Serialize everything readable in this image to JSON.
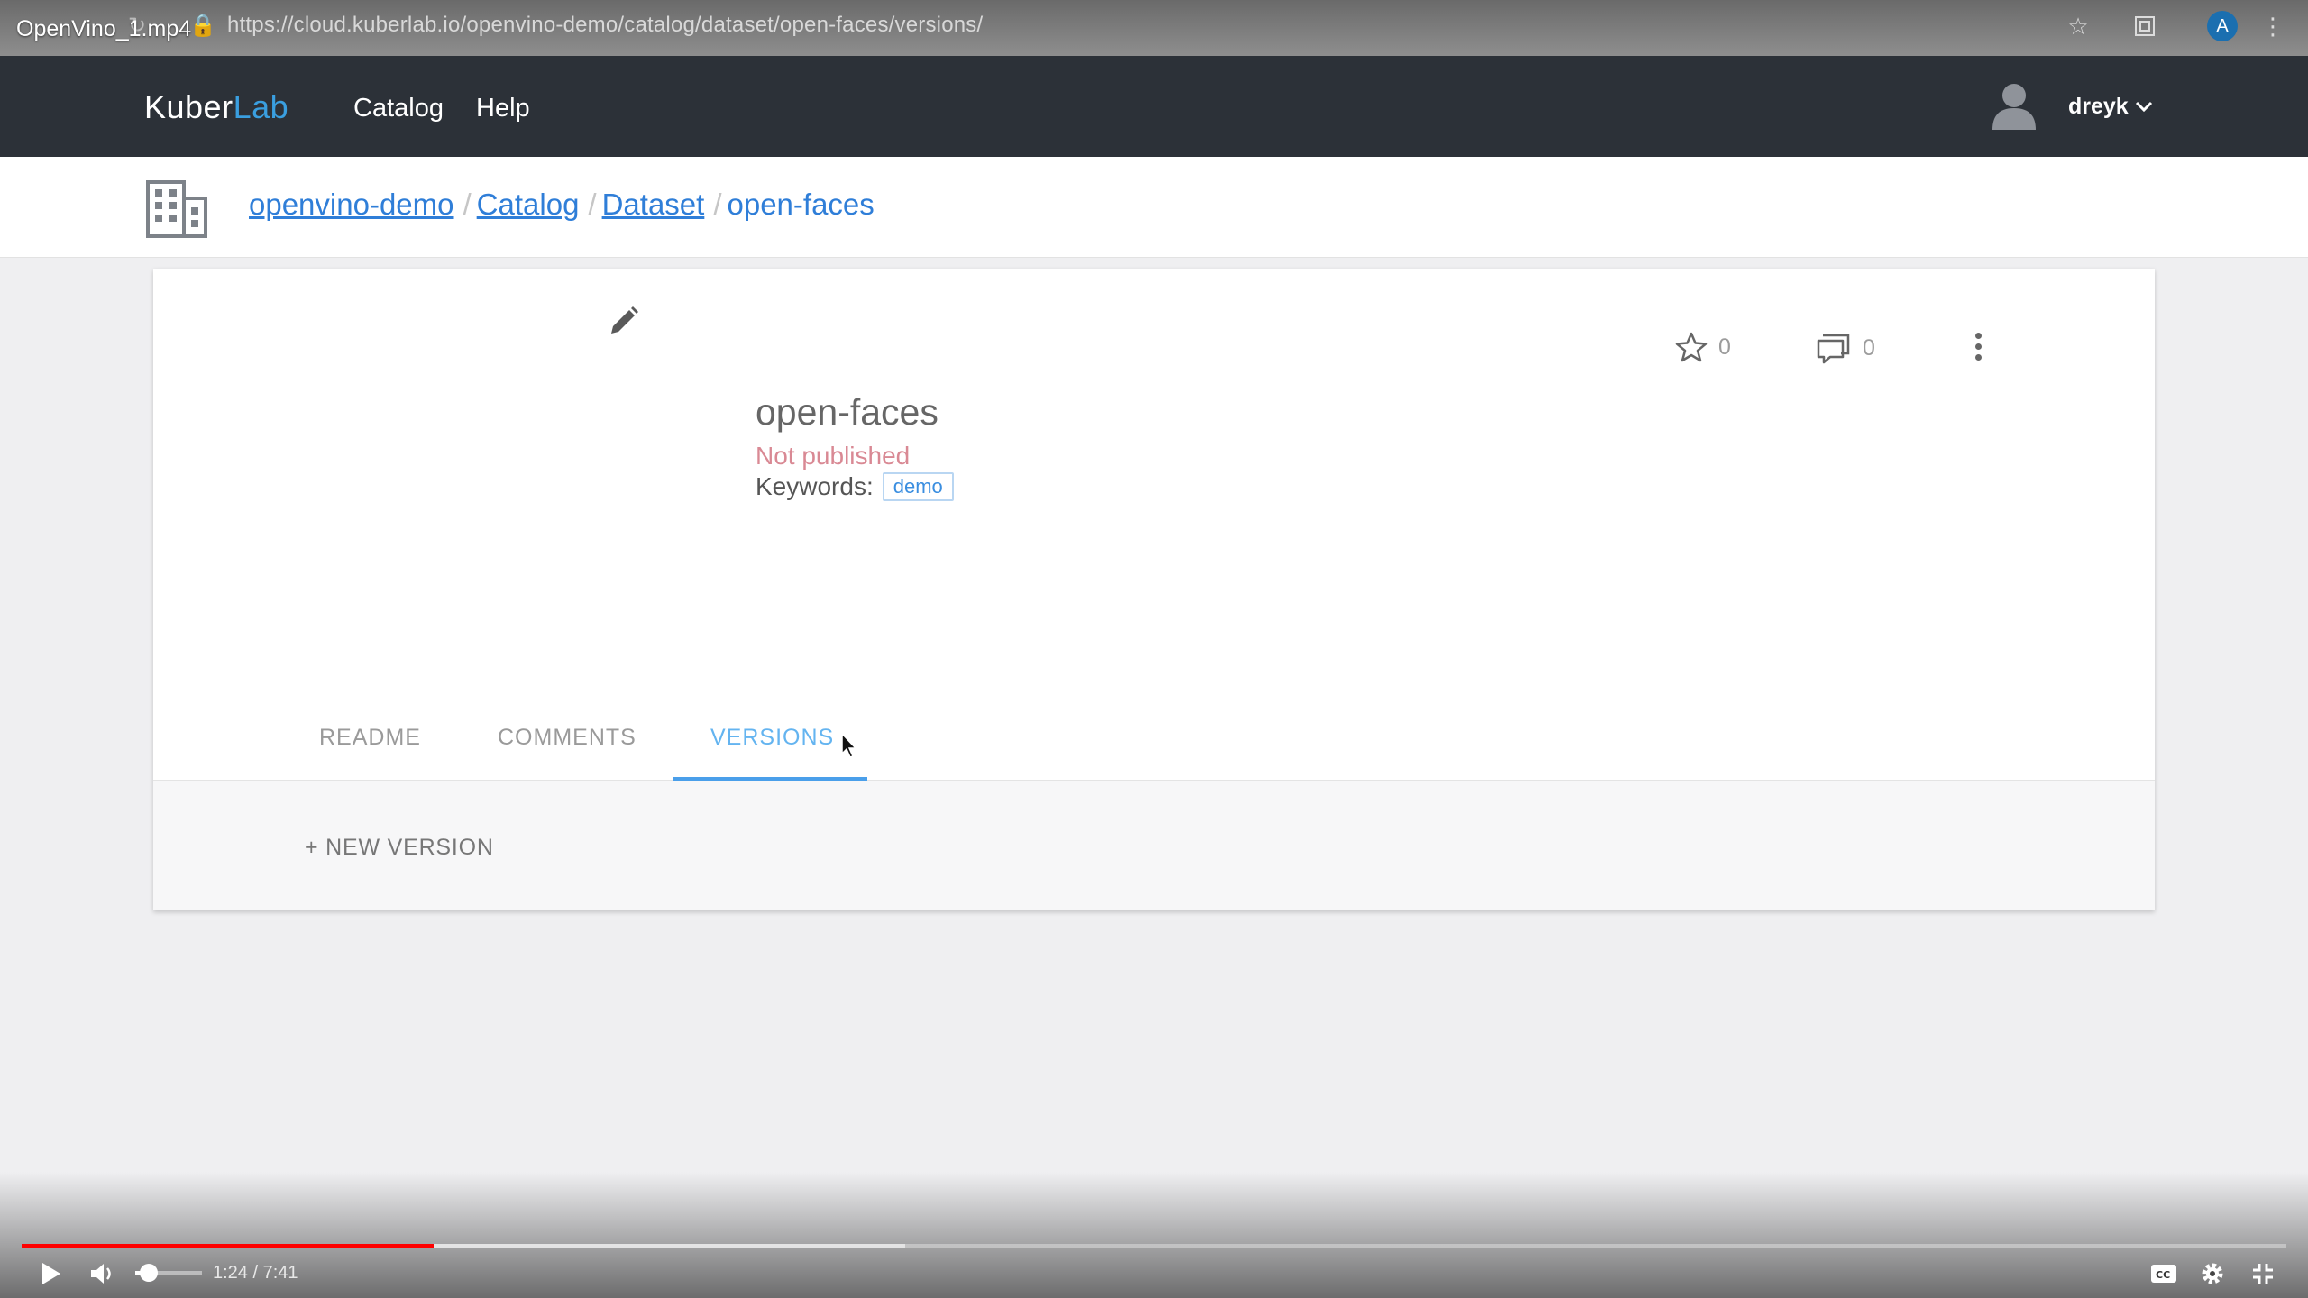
{
  "video": {
    "title": "OpenVino_1.mp4",
    "time": "1:24 / 7:41",
    "played_fraction": 0.182,
    "buffered_fraction": 0.39,
    "volume_fraction": 0.2
  },
  "browser": {
    "url": "https://cloud.kuberlab.io/openvino-demo/catalog/dataset/open-faces/versions/",
    "avatar_initial": "A"
  },
  "header": {
    "logo_part1": "Kuber",
    "logo_part2": "Lab",
    "nav": [
      "Catalog",
      "Help"
    ],
    "username": "dreyk"
  },
  "breadcrumb": {
    "items": [
      "openvino-demo",
      "Catalog",
      "Dataset"
    ],
    "current": "open-faces",
    "separator": "/"
  },
  "item": {
    "title": "open-faces",
    "status": "Not published",
    "keywords_label": "Keywords:",
    "keywords": [
      "demo"
    ],
    "stars": "0",
    "comments": "0"
  },
  "tabs": [
    {
      "label": "README"
    },
    {
      "label": "COMMENTS"
    },
    {
      "label": "VERSIONS"
    }
  ],
  "active_tab": "VERSIONS",
  "versions": {
    "new_version_label": "+ NEW VERSION"
  },
  "colors": {
    "header_bg": "#2c3138",
    "link": "#2f7ed8",
    "accent": "#4a9fea",
    "status_unpublished": "#d98994",
    "progress": "#ff0000"
  }
}
